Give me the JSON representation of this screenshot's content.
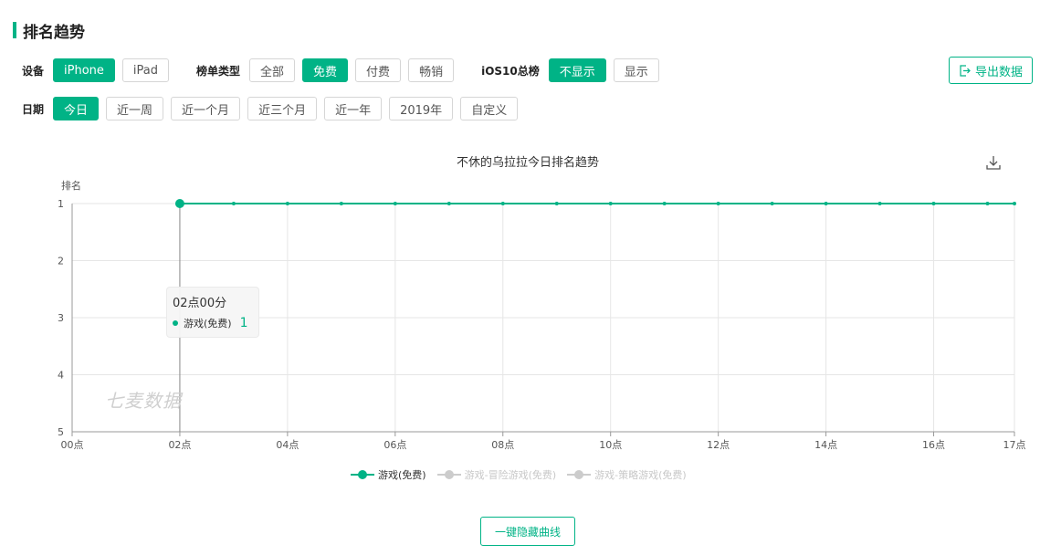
{
  "section_title": "排名趋势",
  "filters": {
    "device": {
      "label": "设备",
      "options": [
        "iPhone",
        "iPad"
      ],
      "selected": "iPhone"
    },
    "list_type": {
      "label": "榜单类型",
      "options": [
        "全部",
        "免费",
        "付费",
        "畅销"
      ],
      "selected": "免费"
    },
    "ios10": {
      "label": "iOS10总榜",
      "options": [
        "不显示",
        "显示"
      ],
      "selected": "不显示"
    },
    "date": {
      "label": "日期",
      "options": [
        "今日",
        "近一周",
        "近一个月",
        "近三个月",
        "近一年",
        "2019年",
        "自定义"
      ],
      "selected": "今日"
    }
  },
  "export_label": "导出数据",
  "watermark": "七麦数据",
  "hide_curves_label": "一键隐藏曲线",
  "tooltip": {
    "time": "02点00分",
    "series": "游戏(免费)",
    "value": "1"
  },
  "colors": {
    "accent": "#00b386",
    "inactive": "#cccccc"
  },
  "icons": {
    "export": "export-icon",
    "download": "download-icon"
  },
  "chart_data": {
    "type": "line",
    "title": "不休的乌拉拉今日排名趋势",
    "ylabel": "排名",
    "xlabel": "",
    "ylim": [
      1,
      5
    ],
    "y_inverted": true,
    "y_ticks": [
      1,
      2,
      3,
      4,
      5
    ],
    "xlim": [
      0,
      17.5
    ],
    "x_ticks": [
      {
        "value": 0,
        "label": "00点"
      },
      {
        "value": 2,
        "label": "02点"
      },
      {
        "value": 4,
        "label": "04点"
      },
      {
        "value": 6,
        "label": "06点"
      },
      {
        "value": 8,
        "label": "08点"
      },
      {
        "value": 10,
        "label": "10点"
      },
      {
        "value": 12,
        "label": "12点"
      },
      {
        "value": 14,
        "label": "14点"
      },
      {
        "value": 16,
        "label": "16点"
      },
      {
        "value": 17.5,
        "label": "17点"
      }
    ],
    "grid": true,
    "legend_position": "bottom-center",
    "series": [
      {
        "name": "游戏(免费)",
        "active": true,
        "color": "#00b386",
        "x": [
          2,
          3,
          4,
          5,
          6,
          7,
          8,
          9,
          10,
          11,
          12,
          13,
          14,
          15,
          16,
          17,
          17.5
        ],
        "y": [
          1,
          1,
          1,
          1,
          1,
          1,
          1,
          1,
          1,
          1,
          1,
          1,
          1,
          1,
          1,
          1,
          1
        ]
      },
      {
        "name": "游戏-冒险游戏(免费)",
        "active": false,
        "color": "#cccccc",
        "x": [],
        "y": []
      },
      {
        "name": "游戏-策略游戏(免费)",
        "active": false,
        "color": "#cccccc",
        "x": [],
        "y": []
      }
    ],
    "highlight": {
      "x": 2,
      "y": 1
    }
  }
}
